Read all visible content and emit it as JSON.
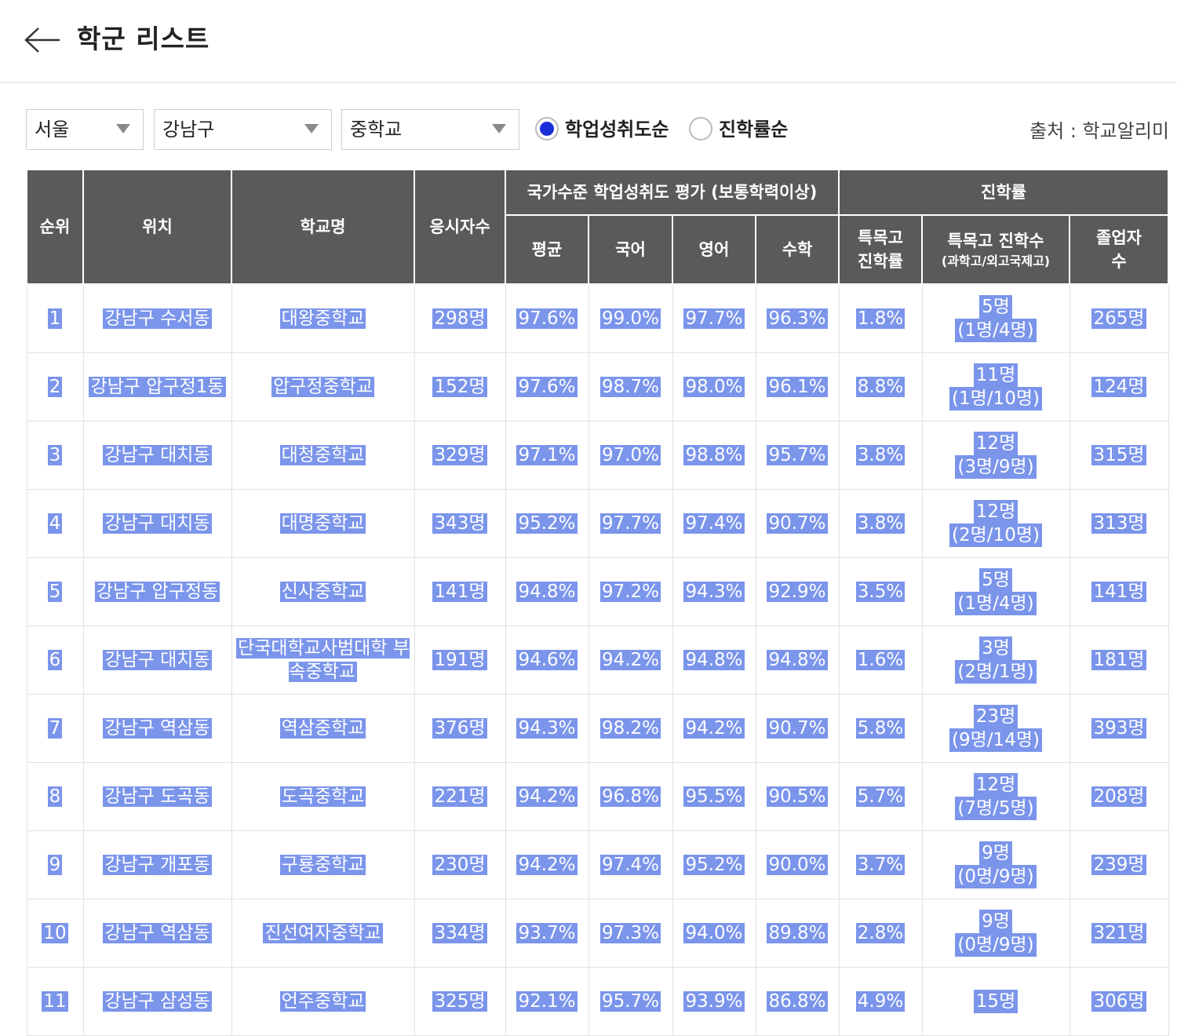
{
  "header": {
    "title": "학군 리스트"
  },
  "filters": {
    "city": "서울",
    "district": "강남구",
    "school_level": "중학교",
    "sort_options": [
      {
        "label": "학업성취도순",
        "selected": true
      },
      {
        "label": "진학률순",
        "selected": false
      }
    ],
    "source": "출처 : 학교알리미"
  },
  "table": {
    "headers": {
      "rank": "순위",
      "location": "위치",
      "school": "학교명",
      "examinees": "응시자수",
      "assessment_group": "국가수준 학업성취도 평가 (보통학력이상)",
      "advance_group": "진학률",
      "average": "평균",
      "korean": "국어",
      "english": "영어",
      "math": "수학",
      "special_rate_line1": "특목고",
      "special_rate_line2": "진학률",
      "special_count": "특목고 진학수",
      "special_count_sub": "(과학고/외고국제고)",
      "graduates_line1": "졸업자",
      "graduates_line2": "수"
    },
    "rows": [
      {
        "rank": "1",
        "location": "강남구 수서동",
        "school": "대왕중학교",
        "examinees": "298명",
        "average": "97.6%",
        "korean": "99.0%",
        "english": "97.7%",
        "math": "96.3%",
        "special_rate": "1.8%",
        "special_count": "5명",
        "special_detail": "(1명/4명)",
        "graduates": "265명"
      },
      {
        "rank": "2",
        "location": "강남구 압구정1동",
        "school": "압구정중학교",
        "examinees": "152명",
        "average": "97.6%",
        "korean": "98.7%",
        "english": "98.0%",
        "math": "96.1%",
        "special_rate": "8.8%",
        "special_count": "11명",
        "special_detail": "(1명/10명)",
        "graduates": "124명"
      },
      {
        "rank": "3",
        "location": "강남구 대치동",
        "school": "대청중학교",
        "examinees": "329명",
        "average": "97.1%",
        "korean": "97.0%",
        "english": "98.8%",
        "math": "95.7%",
        "special_rate": "3.8%",
        "special_count": "12명",
        "special_detail": "(3명/9명)",
        "graduates": "315명"
      },
      {
        "rank": "4",
        "location": "강남구 대치동",
        "school": "대명중학교",
        "examinees": "343명",
        "average": "95.2%",
        "korean": "97.7%",
        "english": "97.4%",
        "math": "90.7%",
        "special_rate": "3.8%",
        "special_count": "12명",
        "special_detail": "(2명/10명)",
        "graduates": "313명"
      },
      {
        "rank": "5",
        "location": "강남구 압구정동",
        "school": "신사중학교",
        "examinees": "141명",
        "average": "94.8%",
        "korean": "97.2%",
        "english": "94.3%",
        "math": "92.9%",
        "special_rate": "3.5%",
        "special_count": "5명",
        "special_detail": "(1명/4명)",
        "graduates": "141명"
      },
      {
        "rank": "6",
        "location": "강남구 대치동",
        "school": "단국대학교사범대학 부속중학교",
        "examinees": "191명",
        "average": "94.6%",
        "korean": "94.2%",
        "english": "94.8%",
        "math": "94.8%",
        "special_rate": "1.6%",
        "special_count": "3명",
        "special_detail": "(2명/1명)",
        "graduates": "181명"
      },
      {
        "rank": "7",
        "location": "강남구 역삼동",
        "school": "역삼중학교",
        "examinees": "376명",
        "average": "94.3%",
        "korean": "98.2%",
        "english": "94.2%",
        "math": "90.7%",
        "special_rate": "5.8%",
        "special_count": "23명",
        "special_detail": "(9명/14명)",
        "graduates": "393명"
      },
      {
        "rank": "8",
        "location": "강남구 도곡동",
        "school": "도곡중학교",
        "examinees": "221명",
        "average": "94.2%",
        "korean": "96.8%",
        "english": "95.5%",
        "math": "90.5%",
        "special_rate": "5.7%",
        "special_count": "12명",
        "special_detail": "(7명/5명)",
        "graduates": "208명"
      },
      {
        "rank": "9",
        "location": "강남구 개포동",
        "school": "구룡중학교",
        "examinees": "230명",
        "average": "94.2%",
        "korean": "97.4%",
        "english": "95.2%",
        "math": "90.0%",
        "special_rate": "3.7%",
        "special_count": "9명",
        "special_detail": "(0명/9명)",
        "graduates": "239명"
      },
      {
        "rank": "10",
        "location": "강남구 역삼동",
        "school": "진선여자중학교",
        "examinees": "334명",
        "average": "93.7%",
        "korean": "97.3%",
        "english": "94.0%",
        "math": "89.8%",
        "special_rate": "2.8%",
        "special_count": "9명",
        "special_detail": "(0명/9명)",
        "graduates": "321명"
      },
      {
        "rank": "11",
        "location": "강남구 삼성동",
        "school": "언주중학교",
        "examinees": "325명",
        "average": "92.1%",
        "korean": "95.7%",
        "english": "93.9%",
        "math": "86.8%",
        "special_rate": "4.9%",
        "special_count": "15명",
        "special_detail": "",
        "graduates": "306명"
      }
    ]
  }
}
